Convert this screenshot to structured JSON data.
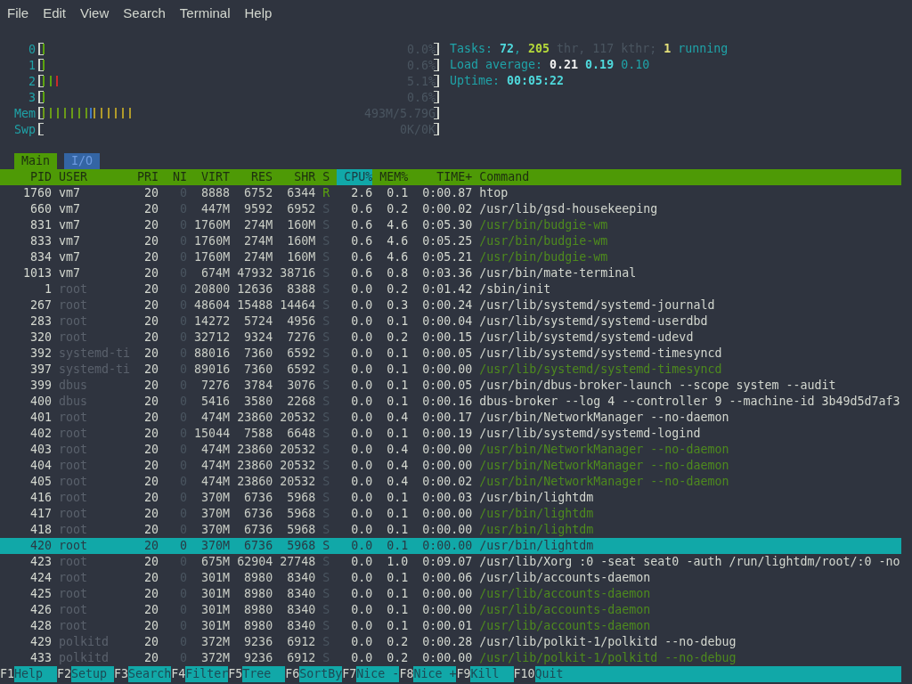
{
  "menu": [
    "File",
    "Edit",
    "View",
    "Search",
    "Terminal",
    "Help"
  ],
  "meters": [
    {
      "label": "0",
      "segments": [
        {
          "kind": "normal",
          "level": 0.004
        }
      ],
      "reading": "0.0%"
    },
    {
      "label": "1",
      "segments": [
        {
          "kind": "normal",
          "level": 0.006
        }
      ],
      "reading": "0.6%"
    },
    {
      "label": "2",
      "segments": [
        {
          "kind": "normal",
          "level": 0.035
        },
        {
          "kind": "kernel",
          "level": 0.016
        }
      ],
      "reading": "5.1%"
    },
    {
      "label": "3",
      "segments": [
        {
          "kind": "normal",
          "level": 0.006
        }
      ],
      "reading": "0.6%"
    },
    {
      "label": "Mem",
      "segments": [
        {
          "kind": "used",
          "level": 0.12
        },
        {
          "kind": "buffers",
          "level": 0.01
        },
        {
          "kind": "cache",
          "level": 0.1
        }
      ],
      "reading": "493M/5.79G"
    },
    {
      "label": "Swp",
      "reading": "0K/0K"
    }
  ],
  "summary": [
    [
      {
        "text": "Tasks: ",
        "kind": "label"
      },
      {
        "text": "72",
        "kind": "value"
      },
      {
        "text": ", ",
        "kind": "label"
      },
      {
        "text": "205",
        "kind": "threads"
      },
      {
        "text": " thr, 117 kthr; ",
        "kind": "dim"
      },
      {
        "text": "1",
        "kind": "running"
      },
      {
        "text": " running",
        "kind": "label"
      }
    ],
    [
      {
        "text": "Load average: ",
        "kind": "label"
      },
      {
        "text": "0.21",
        "kind": "load1"
      },
      {
        "text": "0.19",
        "kind": "load5"
      },
      {
        "text": "0.10",
        "kind": "load15"
      }
    ],
    [
      {
        "text": "Uptime: ",
        "kind": "label"
      },
      {
        "text": "00:05:22",
        "kind": "value"
      }
    ]
  ],
  "tabs": [
    {
      "label": "Main",
      "selected": true
    },
    {
      "label": "I/O",
      "selected": false
    }
  ],
  "columns": [
    {
      "label": "PID",
      "sorted": false
    },
    {
      "label": "USER",
      "sorted": false
    },
    {
      "label": "PRI",
      "sorted": false
    },
    {
      "label": "NI",
      "sorted": false
    },
    {
      "label": "VIRT",
      "sorted": false
    },
    {
      "label": "RES",
      "sorted": false
    },
    {
      "label": "SHR",
      "sorted": false
    },
    {
      "label": "S",
      "sorted": false
    },
    {
      "label": "CPU%",
      "sorted": true
    },
    {
      "label": "MEM%",
      "sorted": false
    },
    {
      "label": "TIME+",
      "sorted": false
    },
    {
      "label": "Command",
      "sorted": false
    }
  ],
  "rows": [
    {
      "cells": [
        "1760",
        "vm7",
        "20",
        "0",
        "8888",
        "6752",
        "6344",
        "R",
        "2.6",
        "0.1",
        "0:00.87",
        "htop"
      ],
      "own": true,
      "running": true,
      "thread": false,
      "selected": false
    },
    {
      "cells": [
        "660",
        "vm7",
        "20",
        "0",
        "447M",
        "9592",
        "6952",
        "S",
        "0.6",
        "0.2",
        "0:00.02",
        "/usr/lib/gsd-housekeeping"
      ],
      "own": true,
      "running": false,
      "thread": false,
      "selected": false
    },
    {
      "cells": [
        "831",
        "vm7",
        "20",
        "0",
        "1760M",
        "274M",
        "160M",
        "S",
        "0.6",
        "4.6",
        "0:05.30",
        "/usr/bin/budgie-wm"
      ],
      "own": true,
      "running": false,
      "thread": true,
      "selected": false
    },
    {
      "cells": [
        "833",
        "vm7",
        "20",
        "0",
        "1760M",
        "274M",
        "160M",
        "S",
        "0.6",
        "4.6",
        "0:05.25",
        "/usr/bin/budgie-wm"
      ],
      "own": true,
      "running": false,
      "thread": true,
      "selected": false
    },
    {
      "cells": [
        "834",
        "vm7",
        "20",
        "0",
        "1760M",
        "274M",
        "160M",
        "S",
        "0.6",
        "4.6",
        "0:05.21",
        "/usr/bin/budgie-wm"
      ],
      "own": true,
      "running": false,
      "thread": true,
      "selected": false
    },
    {
      "cells": [
        "1013",
        "vm7",
        "20",
        "0",
        "674M",
        "47932",
        "38716",
        "S",
        "0.6",
        "0.8",
        "0:03.36",
        "/usr/bin/mate-terminal"
      ],
      "own": true,
      "running": false,
      "thread": false,
      "selected": false
    },
    {
      "cells": [
        "1",
        "root",
        "20",
        "0",
        "20800",
        "12636",
        "8388",
        "S",
        "0.0",
        "0.2",
        "0:01.42",
        "/sbin/init"
      ],
      "own": false,
      "running": false,
      "thread": false,
      "selected": false
    },
    {
      "cells": [
        "267",
        "root",
        "20",
        "0",
        "48604",
        "15488",
        "14464",
        "S",
        "0.0",
        "0.3",
        "0:00.24",
        "/usr/lib/systemd/systemd-journald"
      ],
      "own": false,
      "running": false,
      "thread": false,
      "selected": false
    },
    {
      "cells": [
        "283",
        "root",
        "20",
        "0",
        "14272",
        "5724",
        "4956",
        "S",
        "0.0",
        "0.1",
        "0:00.04",
        "/usr/lib/systemd/systemd-userdbd"
      ],
      "own": false,
      "running": false,
      "thread": false,
      "selected": false
    },
    {
      "cells": [
        "320",
        "root",
        "20",
        "0",
        "32712",
        "9324",
        "7276",
        "S",
        "0.0",
        "0.2",
        "0:00.15",
        "/usr/lib/systemd/systemd-udevd"
      ],
      "own": false,
      "running": false,
      "thread": false,
      "selected": false
    },
    {
      "cells": [
        "392",
        "systemd-ti",
        "20",
        "0",
        "88016",
        "7360",
        "6592",
        "S",
        "0.0",
        "0.1",
        "0:00.05",
        "/usr/lib/systemd/systemd-timesyncd"
      ],
      "own": false,
      "running": false,
      "thread": false,
      "selected": false
    },
    {
      "cells": [
        "397",
        "systemd-ti",
        "20",
        "0",
        "89016",
        "7360",
        "6592",
        "S",
        "0.0",
        "0.1",
        "0:00.00",
        "/usr/lib/systemd/systemd-timesyncd"
      ],
      "own": false,
      "running": false,
      "thread": true,
      "selected": false
    },
    {
      "cells": [
        "399",
        "dbus",
        "20",
        "0",
        "7276",
        "3784",
        "3076",
        "S",
        "0.0",
        "0.1",
        "0:00.05",
        "/usr/bin/dbus-broker-launch --scope system --audit"
      ],
      "own": false,
      "running": false,
      "thread": false,
      "selected": false
    },
    {
      "cells": [
        "400",
        "dbus",
        "20",
        "0",
        "5416",
        "3580",
        "2268",
        "S",
        "0.0",
        "0.1",
        "0:00.16",
        "dbus-broker --log 4 --controller 9 --machine-id 3b49d5d7af3"
      ],
      "own": false,
      "running": false,
      "thread": false,
      "selected": false
    },
    {
      "cells": [
        "401",
        "root",
        "20",
        "0",
        "474M",
        "23860",
        "20532",
        "S",
        "0.0",
        "0.4",
        "0:00.17",
        "/usr/bin/NetworkManager --no-daemon"
      ],
      "own": false,
      "running": false,
      "thread": false,
      "selected": false
    },
    {
      "cells": [
        "402",
        "root",
        "20",
        "0",
        "15044",
        "7588",
        "6648",
        "S",
        "0.0",
        "0.1",
        "0:00.19",
        "/usr/lib/systemd/systemd-logind"
      ],
      "own": false,
      "running": false,
      "thread": false,
      "selected": false
    },
    {
      "cells": [
        "403",
        "root",
        "20",
        "0",
        "474M",
        "23860",
        "20532",
        "S",
        "0.0",
        "0.4",
        "0:00.00",
        "/usr/bin/NetworkManager --no-daemon"
      ],
      "own": false,
      "running": false,
      "thread": true,
      "selected": false
    },
    {
      "cells": [
        "404",
        "root",
        "20",
        "0",
        "474M",
        "23860",
        "20532",
        "S",
        "0.0",
        "0.4",
        "0:00.00",
        "/usr/bin/NetworkManager --no-daemon"
      ],
      "own": false,
      "running": false,
      "thread": true,
      "selected": false
    },
    {
      "cells": [
        "405",
        "root",
        "20",
        "0",
        "474M",
        "23860",
        "20532",
        "S",
        "0.0",
        "0.4",
        "0:00.02",
        "/usr/bin/NetworkManager --no-daemon"
      ],
      "own": false,
      "running": false,
      "thread": true,
      "selected": false
    },
    {
      "cells": [
        "416",
        "root",
        "20",
        "0",
        "370M",
        "6736",
        "5968",
        "S",
        "0.0",
        "0.1",
        "0:00.03",
        "/usr/bin/lightdm"
      ],
      "own": false,
      "running": false,
      "thread": false,
      "selected": false
    },
    {
      "cells": [
        "417",
        "root",
        "20",
        "0",
        "370M",
        "6736",
        "5968",
        "S",
        "0.0",
        "0.1",
        "0:00.00",
        "/usr/bin/lightdm"
      ],
      "own": false,
      "running": false,
      "thread": true,
      "selected": false
    },
    {
      "cells": [
        "418",
        "root",
        "20",
        "0",
        "370M",
        "6736",
        "5968",
        "S",
        "0.0",
        "0.1",
        "0:00.00",
        "/usr/bin/lightdm"
      ],
      "own": false,
      "running": false,
      "thread": true,
      "selected": false
    },
    {
      "cells": [
        "420",
        "root",
        "20",
        "0",
        "370M",
        "6736",
        "5968",
        "S",
        "0.0",
        "0.1",
        "0:00.00",
        "/usr/bin/lightdm"
      ],
      "own": false,
      "running": false,
      "thread": true,
      "selected": true
    },
    {
      "cells": [
        "423",
        "root",
        "20",
        "0",
        "675M",
        "62904",
        "27748",
        "S",
        "0.0",
        "1.0",
        "0:09.07",
        "/usr/lib/Xorg :0 -seat seat0 -auth /run/lightdm/root/:0 -no"
      ],
      "own": false,
      "running": false,
      "thread": false,
      "selected": false
    },
    {
      "cells": [
        "424",
        "root",
        "20",
        "0",
        "301M",
        "8980",
        "8340",
        "S",
        "0.0",
        "0.1",
        "0:00.06",
        "/usr/lib/accounts-daemon"
      ],
      "own": false,
      "running": false,
      "thread": false,
      "selected": false
    },
    {
      "cells": [
        "425",
        "root",
        "20",
        "0",
        "301M",
        "8980",
        "8340",
        "S",
        "0.0",
        "0.1",
        "0:00.00",
        "/usr/lib/accounts-daemon"
      ],
      "own": false,
      "running": false,
      "thread": true,
      "selected": false
    },
    {
      "cells": [
        "426",
        "root",
        "20",
        "0",
        "301M",
        "8980",
        "8340",
        "S",
        "0.0",
        "0.1",
        "0:00.00",
        "/usr/lib/accounts-daemon"
      ],
      "own": false,
      "running": false,
      "thread": true,
      "selected": false
    },
    {
      "cells": [
        "428",
        "root",
        "20",
        "0",
        "301M",
        "8980",
        "8340",
        "S",
        "0.0",
        "0.1",
        "0:00.01",
        "/usr/lib/accounts-daemon"
      ],
      "own": false,
      "running": false,
      "thread": true,
      "selected": false
    },
    {
      "cells": [
        "429",
        "polkitd",
        "20",
        "0",
        "372M",
        "9236",
        "6912",
        "S",
        "0.0",
        "0.2",
        "0:00.28",
        "/usr/lib/polkit-1/polkitd --no-debug"
      ],
      "own": false,
      "running": false,
      "thread": false,
      "selected": false
    },
    {
      "cells": [
        "433",
        "polkitd",
        "20",
        "0",
        "372M",
        "9236",
        "6912",
        "S",
        "0.0",
        "0.2",
        "0:00.00",
        "/usr/lib/polkit-1/polkitd --no-debug"
      ],
      "own": false,
      "running": false,
      "thread": true,
      "selected": false
    }
  ],
  "footer": [
    {
      "key": "F1",
      "label": "Help"
    },
    {
      "key": "F2",
      "label": "Setup"
    },
    {
      "key": "F3",
      "label": "Search"
    },
    {
      "key": "F4",
      "label": "Filter"
    },
    {
      "key": "F5",
      "label": "Tree"
    },
    {
      "key": "F6",
      "label": "SortBy"
    },
    {
      "key": "F7",
      "label": "Nice -"
    },
    {
      "key": "F8",
      "label": "Nice +"
    },
    {
      "key": "F9",
      "label": "Kill"
    },
    {
      "key": "F10",
      "label": "Quit"
    }
  ]
}
